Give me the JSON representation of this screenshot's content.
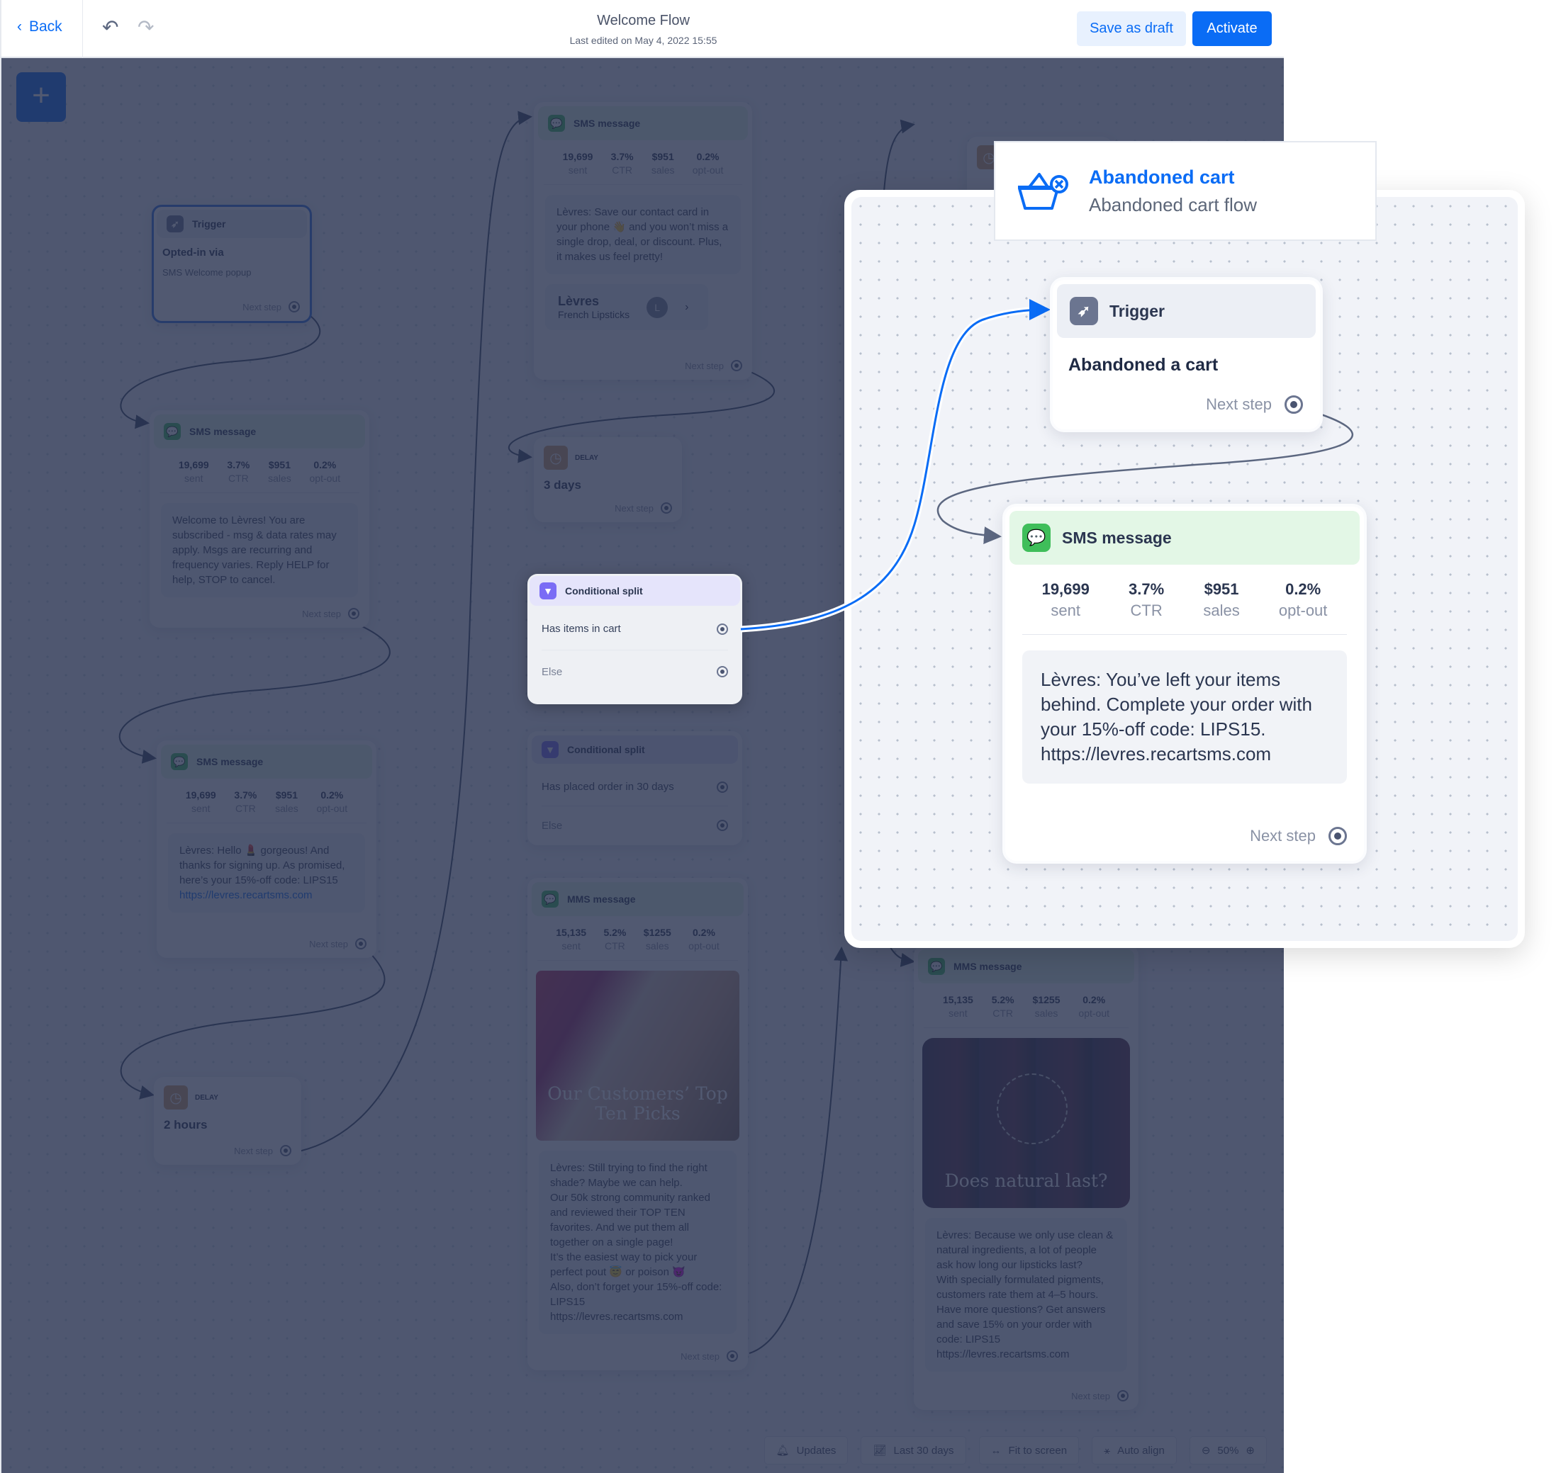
{
  "header": {
    "back_label": "Back",
    "title": "Welcome Flow",
    "subtitle": "Last edited on May 4, 2022 15:55",
    "save_draft_label": "Save as draft",
    "activate_label": "Activate"
  },
  "canvas": {
    "add_icon": "+",
    "trigger": {
      "title": "Trigger",
      "heading": "Opted-in via",
      "sub": "SMS Welcome popup",
      "next": "Next step"
    },
    "sms_welcome": {
      "title": "SMS message",
      "stats": [
        {
          "value": "19,699",
          "label": "sent"
        },
        {
          "value": "3.7%",
          "label": "CTR"
        },
        {
          "value": "$951",
          "label": "sales"
        },
        {
          "value": "0.2%",
          "label": "opt-out"
        }
      ],
      "body": "Welcome to Lèvres! You are subscribed - msg & data rates may apply. Msgs are recurring and frequency varies. Reply HELP for help, STOP to cancel.",
      "next": "Next step"
    },
    "sms_hello": {
      "title": "SMS message",
      "stats": [
        {
          "value": "19,699",
          "label": "sent"
        },
        {
          "value": "3.7%",
          "label": "CTR"
        },
        {
          "value": "$951",
          "label": "sales"
        },
        {
          "value": "0.2%",
          "label": "opt-out"
        }
      ],
      "body": "Lèvres: Hello 💄 gorgeous! And thanks for signing up. As promised, here’s your 15%-off code: LIPS15",
      "link": "https://levres.recartsms.com",
      "next": "Next step"
    },
    "delay_hours": {
      "label": "DELAY",
      "value": "2 hours",
      "next": "Next step"
    },
    "sms_contact": {
      "title": "SMS message",
      "stats": [
        {
          "value": "19,699",
          "label": "sent"
        },
        {
          "value": "3.7%",
          "label": "CTR"
        },
        {
          "value": "$951",
          "label": "sales"
        },
        {
          "value": "0.2%",
          "label": "opt-out"
        }
      ],
      "body": "Lèvres: Save our contact card in your phone 👋 and you won’t miss a single drop, deal, or discount. Plus, it makes us feel pretty!",
      "contact_name": "Lèvres",
      "contact_sub": "French Lipsticks",
      "contact_avatar": "L",
      "next": "Next step"
    },
    "delay_days": {
      "label": "DELAY",
      "value": "3 days",
      "next": "Next step"
    },
    "split_cart": {
      "title": "Conditional split",
      "branches": [
        "Has items in cart",
        "Else"
      ]
    },
    "split_order": {
      "title": "Conditional split",
      "branches": [
        "Has placed order in 30 days",
        "Else"
      ]
    },
    "mms_picks": {
      "title": "MMS message",
      "stats": [
        {
          "value": "15,135",
          "label": "sent"
        },
        {
          "value": "5.2%",
          "label": "CTR"
        },
        {
          "value": "$1255",
          "label": "sales"
        },
        {
          "value": "0.2%",
          "label": "opt-out"
        }
      ],
      "image_caption": "Our Customers’ Top Ten Picks",
      "body": "Lèvres: Still trying to find the right shade? Maybe we can help.\nOur 50k strong community ranked and reviewed their TOP TEN favorites. And we put them all together on a single page!\nIt’s the easiest way to pick your perfect pout 😇 or poison 😈\nAlso, don’t forget your 15%-off code: LIPS15\nhttps://levres.recartsms.com",
      "next": "Next step"
    },
    "mms_natural": {
      "title": "MMS message",
      "stats": [
        {
          "value": "15,135",
          "label": "sent"
        },
        {
          "value": "5.2%",
          "label": "CTR"
        },
        {
          "value": "$1255",
          "label": "sales"
        },
        {
          "value": "0.2%",
          "label": "opt-out"
        }
      ],
      "image_caption": "Does natural last?",
      "body": "Lèvres: Because we only use clean & natural ingredients, a lot of people ask how long our lipsticks last?\nWith specially formulated pigments, customers rate them at 4–5 hours.\nHave more questions? Get answers and save 15% on your order with code: LIPS15\nhttps://levres.recartsms.com",
      "next": "Next step"
    }
  },
  "toolbar": {
    "updates": "Updates",
    "last_30_days": "Last 30 days",
    "fit_to_screen": "Fit to screen",
    "auto_align": "Auto align",
    "zoom": "50%"
  },
  "popup": {
    "flow_title": "Abandoned cart",
    "flow_subtitle": "Abandoned cart flow",
    "trigger": {
      "title": "Trigger",
      "heading": "Abandoned a cart",
      "next": "Next step"
    },
    "sms": {
      "title": "SMS message",
      "stats": [
        {
          "value": "19,699",
          "label": "sent"
        },
        {
          "value": "3.7%",
          "label": "CTR"
        },
        {
          "value": "$951",
          "label": "sales"
        },
        {
          "value": "0.2%",
          "label": "opt-out"
        }
      ],
      "body": "Lèvres: You’ve left your items behind. Complete your order with your 15%-off code: LIPS15. https://levres.recartsms.com",
      "next": "Next step"
    }
  },
  "colors": {
    "accent": "#0a6cf5",
    "sms_green": "#3fbe5a",
    "split_purple": "#7a6cf5",
    "delay_orange": "#d3a169",
    "overlay": "#26304e"
  }
}
